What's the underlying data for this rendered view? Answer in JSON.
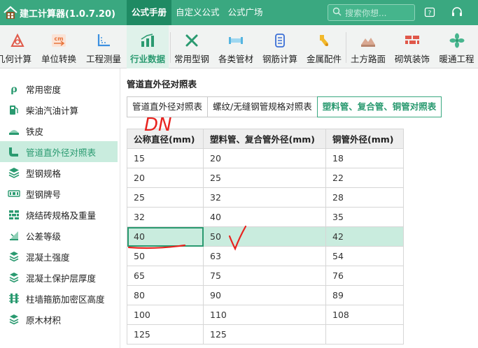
{
  "titlebar": {
    "app_title": "建工计算器(1.0.7.20)",
    "menu": [
      "公式手册",
      "自定义公式",
      "公式广场"
    ],
    "search_placeholder": "搜索你想..."
  },
  "toolbar": {
    "tools": [
      {
        "label": "几何计算",
        "icon": "geometry-icon"
      },
      {
        "label": "单位转换",
        "icon": "unit-convert-icon"
      },
      {
        "label": "工程测量",
        "icon": "survey-icon"
      },
      {
        "label": "行业数据",
        "icon": "industry-data-icon",
        "active": true
      },
      {
        "label": "常用型钢",
        "icon": "steel-section-icon"
      },
      {
        "label": "各类管材",
        "icon": "pipe-icon"
      },
      {
        "label": "钢筋计算",
        "icon": "rebar-icon"
      },
      {
        "label": "金属配件",
        "icon": "metal-fitting-icon"
      },
      {
        "label": "土方路面",
        "icon": "earthwork-icon"
      },
      {
        "label": "砌筑装饰",
        "icon": "masonry-icon"
      },
      {
        "label": "暖通工程",
        "icon": "hvac-icon"
      }
    ]
  },
  "sidebar": {
    "items": [
      {
        "label": "常用密度",
        "icon": "density-icon"
      },
      {
        "label": "柴油汽油计算",
        "icon": "fuel-pump-icon"
      },
      {
        "label": "铁皮",
        "icon": "iron-sheet-icon"
      },
      {
        "label": "管道直外径对照表",
        "icon": "pipe-elbow-icon",
        "active": true
      },
      {
        "label": "型钢规格",
        "icon": "steel-spec-icon"
      },
      {
        "label": "型钢牌号",
        "icon": "steel-grade-icon"
      },
      {
        "label": "烧结砖规格及重量",
        "icon": "brick-icon"
      },
      {
        "label": "公差等级",
        "icon": "tolerance-icon"
      },
      {
        "label": "混凝土强度",
        "icon": "concrete-strength-icon"
      },
      {
        "label": "混凝土保护层厚度",
        "icon": "concrete-cover-icon"
      },
      {
        "label": "柱墙箍筋加密区高度",
        "icon": "stirrup-icon"
      },
      {
        "label": "原木材积",
        "icon": "log-volume-icon"
      }
    ]
  },
  "main": {
    "title": "管道直外径对照表",
    "tabs": [
      {
        "label": "管道直外径对照表"
      },
      {
        "label": "螺纹/无缝钢管规格对照表"
      },
      {
        "label": "塑料管、复合管、铜管对照表",
        "active": true
      }
    ],
    "table": {
      "headers": [
        "公称直径(mm)",
        "塑料管、复合管外径(mm)",
        "铜管外径(mm)"
      ],
      "rows": [
        [
          "15",
          "20",
          "18"
        ],
        [
          "20",
          "25",
          "22"
        ],
        [
          "25",
          "32",
          "28"
        ],
        [
          "32",
          "40",
          "35"
        ],
        [
          "40",
          "50",
          "42"
        ],
        [
          "50",
          "63",
          "54"
        ],
        [
          "65",
          "75",
          "76"
        ],
        [
          "80",
          "90",
          "89"
        ],
        [
          "100",
          "110",
          "108"
        ],
        [
          "125",
          "125",
          ""
        ]
      ],
      "selected_row": 4
    },
    "annotation": {
      "text": "DN"
    }
  },
  "colors": {
    "brand": "#3aa880",
    "brand_dark": "#1f8a63",
    "highlight": "#c9ecde",
    "annotation": "#e8231f"
  }
}
